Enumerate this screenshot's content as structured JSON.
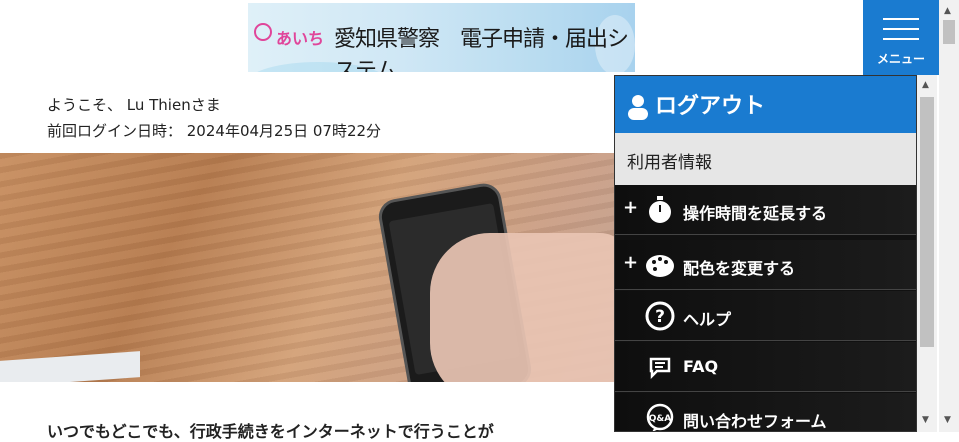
{
  "header": {
    "banner_logo_text": "あいち",
    "banner_title": "愛知県警察　電子申請・届出システム",
    "menu_label": "メニュー"
  },
  "welcome": {
    "line1": "ようこそ、 Lu Thienさま",
    "line2": "前回ログイン日時： 2024年04月25日 07時22分"
  },
  "main": {
    "intro_text": "いつでもどこでも、行政手続きをインターネットで行うことが"
  },
  "menu": {
    "logout_label": "ログアウト",
    "user_info_label": "利用者情報",
    "items": [
      {
        "label": "操作時間を延長する",
        "icon": "stopwatch-icon",
        "expandable": true
      },
      {
        "label": "配色を変更する",
        "icon": "palette-icon",
        "expandable": true
      },
      {
        "label": "ヘルプ",
        "icon": "help-icon",
        "expandable": false
      },
      {
        "label": "FAQ",
        "icon": "faq-icon",
        "expandable": false
      },
      {
        "label": "問い合わせフォーム",
        "icon": "qa-icon",
        "expandable": false
      }
    ]
  },
  "colors": {
    "accent": "#1a7bd0",
    "menu_bg": "#111111",
    "user_info_bg": "#e6e6e6"
  }
}
